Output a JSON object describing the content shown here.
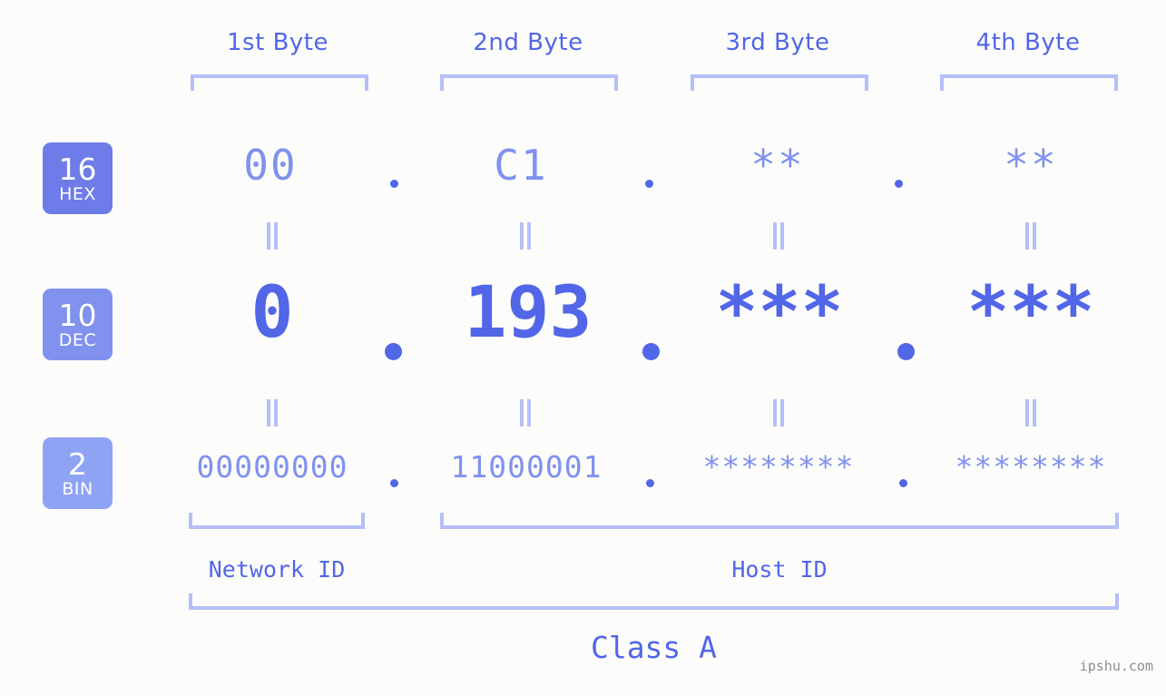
{
  "page": {
    "background_color": "#fcfdfa",
    "accent_color": "#5266e8",
    "light_accent_color": "#b6bff7",
    "mid_accent_color": "#8191ef",
    "watermark": "ipshu.com"
  },
  "byte_headers": [
    {
      "label": "1st Byte"
    },
    {
      "label": "2nd Byte"
    },
    {
      "label": "3rd Byte"
    },
    {
      "label": "4th Byte"
    }
  ],
  "radix_badges": [
    {
      "number": "16",
      "name": "HEX",
      "color": "#6d7ce8"
    },
    {
      "number": "10",
      "name": "DEC",
      "color": "#8091ee"
    },
    {
      "number": "2",
      "name": "BIN",
      "color": "#8fa3f5"
    }
  ],
  "rows": {
    "hex": {
      "radix": "16",
      "values": [
        "00",
        "C1",
        "**",
        "**"
      ],
      "separator": "."
    },
    "dec": {
      "radix": "10",
      "values": [
        "0",
        "193",
        "***",
        "***"
      ],
      "separator": "."
    },
    "bin": {
      "radix": "2",
      "values": [
        "00000000",
        "11000001",
        "********",
        "********"
      ],
      "separator": "."
    }
  },
  "equality_marks": {
    "symbol": "||",
    "rows": 2,
    "columns": 4
  },
  "id_spans": [
    {
      "label": "Network ID",
      "bytes": "1"
    },
    {
      "label": "Host ID",
      "bytes": "2-4"
    }
  ],
  "class_label": "Class A"
}
